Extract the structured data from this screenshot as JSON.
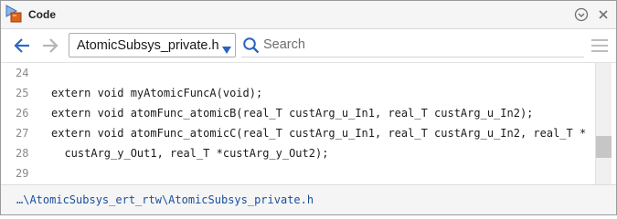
{
  "window": {
    "title": "Code",
    "icon": "matlab-code-icon"
  },
  "titlebar": {
    "menu_icon": "circle-chevron-down-icon",
    "close_icon": "close-icon"
  },
  "toolbar": {
    "back_icon": "arrow-left-icon",
    "forward_icon": "arrow-right-icon",
    "file_selector": {
      "value": "AtomicSubsys_private.h",
      "icon": "caret-down-icon"
    },
    "search": {
      "placeholder": "Search",
      "value": "",
      "icon": "search-icon"
    },
    "menu_icon": "hamburger-menu-icon"
  },
  "code": {
    "lines": [
      {
        "number": "24",
        "text": ""
      },
      {
        "number": "25",
        "text": "extern void myAtomicFuncA(void);"
      },
      {
        "number": "26",
        "text": "extern void atomFunc_atomicB(real_T custArg_u_In1, real_T custArg_u_In2);"
      },
      {
        "number": "27",
        "text": "extern void atomFunc_atomicC(real_T custArg_u_In1, real_T custArg_u_In2, real_T *"
      },
      {
        "number": "28",
        "text": "  custArg_y_Out1, real_T *custArg_y_Out2);"
      },
      {
        "number": "29",
        "text": ""
      }
    ]
  },
  "status_bar": {
    "path": "…\\AtomicSubsys_ert_rtw\\AtomicSubsys_private.h"
  },
  "colors": {
    "path_link": "#1a4f9c",
    "caret_blue": "#2b63c2",
    "nav_back": "#2f68c9",
    "nav_forward_disabled": "#b5b5b5",
    "app_icon_orange": "#e0631b"
  }
}
